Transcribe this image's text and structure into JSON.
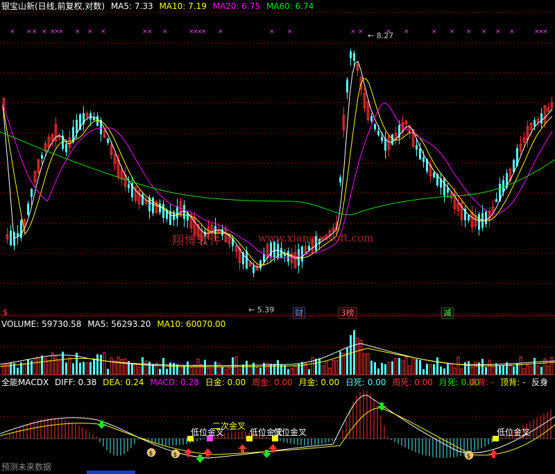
{
  "header": {
    "title": "银宝山新(日线,前复权,对数)",
    "ma5": "MA5: 7.33",
    "ma10": "MA10: 7.19",
    "ma20": "MA20: 6.75",
    "ma60": "MA60: 6.74"
  },
  "price": {
    "high_label": "8.27",
    "low_label": "5.39",
    "badges": {
      "s": "$",
      "cai": "财",
      "bang": "榜",
      "bang_prefix": "3",
      "jian": "减"
    }
  },
  "watermark": {
    "cn": "翔博软件",
    "url": "www.xiangbosoft.com"
  },
  "volume": {
    "label": "VOLUME: 59730.58",
    "ma5": "MA5: 56293.20",
    "ma10": "MA10: 60070.00"
  },
  "macd": {
    "name": "全能MACDX",
    "diff": "DIFF: 0.38",
    "dea": "DEA: 0.24",
    "macd": "MACD: 0.28",
    "rijin": "日金: 0.00",
    "zhoujin": "周金: 0.00",
    "yuejin": "月金: 0.00",
    "risi": "日死: 0.00",
    "zhousi": "周死: 0.00",
    "yuesi": "月死: 0.00",
    "dibei": "底背: -",
    "dingbei": "顶背: -",
    "fanshen": "反身",
    "signals": {
      "a": "低位金叉",
      "b": "二次金叉",
      "c": "低位金叉",
      "d": "低位金叉",
      "e": "低位金叉"
    }
  },
  "footer": {
    "text": "预测未来数据"
  },
  "colors": {
    "up": "#ff3232",
    "down": "#54fcfc",
    "ma5": "#ffffff",
    "ma10": "#ffff00",
    "ma20": "#ff00ff",
    "ma60": "#00e600",
    "grid": "#8b0000"
  }
}
